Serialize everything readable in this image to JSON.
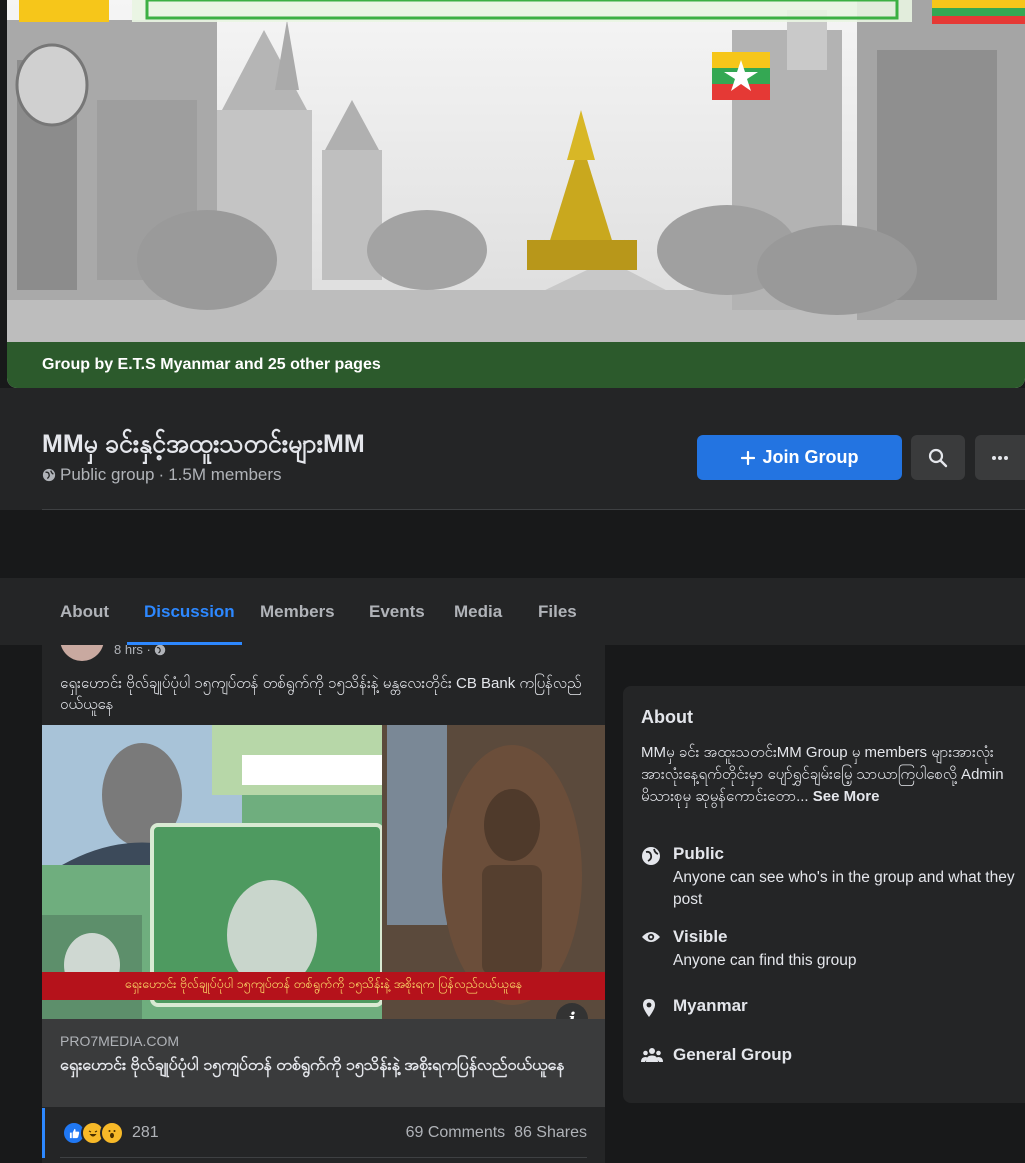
{
  "cover": {
    "caption": "Group by E.T.S Myanmar and 25 other pages"
  },
  "group": {
    "title": "MMမှ ခင်းနှင့်အထူးသတင်းများMM",
    "privacy": "Public group",
    "separator": "·",
    "members": "1.5M members"
  },
  "actions": {
    "join_label": "Join Group",
    "join_icon": "plus-icon",
    "search_icon": "search-icon",
    "more_icon": "more-icon"
  },
  "tabs": [
    {
      "label": "About",
      "active": false
    },
    {
      "label": "Discussion",
      "active": true
    },
    {
      "label": "Members",
      "active": false
    },
    {
      "label": "Events",
      "active": false
    },
    {
      "label": "Media",
      "active": false
    },
    {
      "label": "Files",
      "active": false
    }
  ],
  "post": {
    "time": "8 hrs ·",
    "text": "ရှေးဟောင်း ဗိုလ်ချုပ်ပုံပါ ၁၅ကျပ်တန် တစ်ရွက်ကို ၁၅သိန်းနဲ့ မန္တလေးတိုင်း CB Bank ကပြန်လည်ဝယ်ယူနေ",
    "image_banner": "ရှေးဟောင်း ဗိုလ်ချုပ်ပုံပါ ၁၅ကျပ်တန် တစ်ရွက်ကို ၁၅သိန်းနဲ့ အစိုးရက ပြန်လည်ဝယ်ယူနေ",
    "link_domain": "PRO7MEDIA.COM",
    "link_title": "ရှေးဟောင်း ဗိုလ်ချုပ်ပုံပါ ၁၅ကျပ်တန် တစ်ရွက်ကို ၁၅သိန်းနဲ့ အစိုးရကပြန်လည်ဝယ်ယူနေ",
    "reactions_count": "281",
    "comments": "69 Comments",
    "shares": "86 Shares"
  },
  "about": {
    "heading": "About",
    "description": "MMမှ ခင်း အထူးသတင်းMM Group မှ members များအားလုံး အားလုံးနေ့ရက်တိုင်းမှာ ပျော်ရွှင်ချမ်းမြေ့ သာယာကြပါစေလို့ Admin မိသားစုမှ ဆုမွန်ကောင်းတော...",
    "see_more": "See More",
    "items": [
      {
        "icon": "globe-icon",
        "title": "Public",
        "subtitle": "Anyone can see who's in the group and what they post"
      },
      {
        "icon": "eye-icon",
        "title": "Visible",
        "subtitle": "Anyone can find this group"
      },
      {
        "icon": "location-icon",
        "title": "Myanmar",
        "subtitle": ""
      },
      {
        "icon": "people-icon",
        "title": "General Group",
        "subtitle": ""
      }
    ]
  },
  "colors": {
    "background": "#18191a",
    "card": "#242526",
    "accent": "#2374e1",
    "active_tab": "#2d88ff",
    "cover_caption": "#2c5a2c"
  }
}
